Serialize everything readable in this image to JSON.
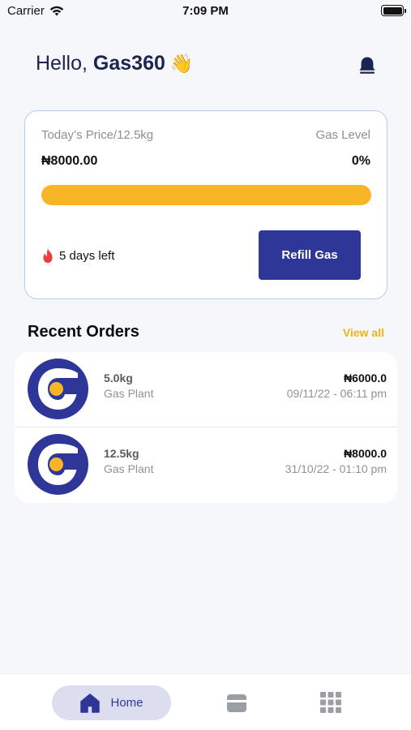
{
  "status_bar": {
    "carrier": "Carrier",
    "time": "7:09 PM",
    "icons": [
      "wifi-icon",
      "battery-icon"
    ]
  },
  "header": {
    "greeting": "Hello,",
    "user_name": "Gas360",
    "wave_emoji": "👋",
    "notification_icon": "bell-icon"
  },
  "gas_card": {
    "price_label": "Today’s Price/12.5kg",
    "price_value": "₦8000.00",
    "level_label": "Gas Level",
    "level_value": "0%",
    "level_fraction": 1.0,
    "days_left": "5 days left",
    "days_icon": "flame-icon",
    "refill_button": "Refill Gas"
  },
  "recent_orders": {
    "title": "Recent Orders",
    "view_all": "View all",
    "items": [
      {
        "weight": "5.0kg",
        "vendor": "Gas Plant",
        "price": "₦6000.0",
        "date": "09/11/22 - 06:11 pm",
        "logo": "gas-plant-logo-icon"
      },
      {
        "weight": "12.5kg",
        "vendor": "Gas Plant",
        "price": "₦8000.0",
        "date": "31/10/22 - 01:10 pm",
        "logo": "gas-plant-logo-icon"
      }
    ]
  },
  "tab_bar": {
    "home_label": "Home",
    "tabs": [
      "home-icon",
      "wallet-icon",
      "grid-menu-icon"
    ]
  },
  "colors": {
    "primary": "#2e3797",
    "accent": "#f8b526",
    "view_all": "#f5b40c",
    "card_border": "#b7cde9",
    "flame": "#e8413c"
  }
}
